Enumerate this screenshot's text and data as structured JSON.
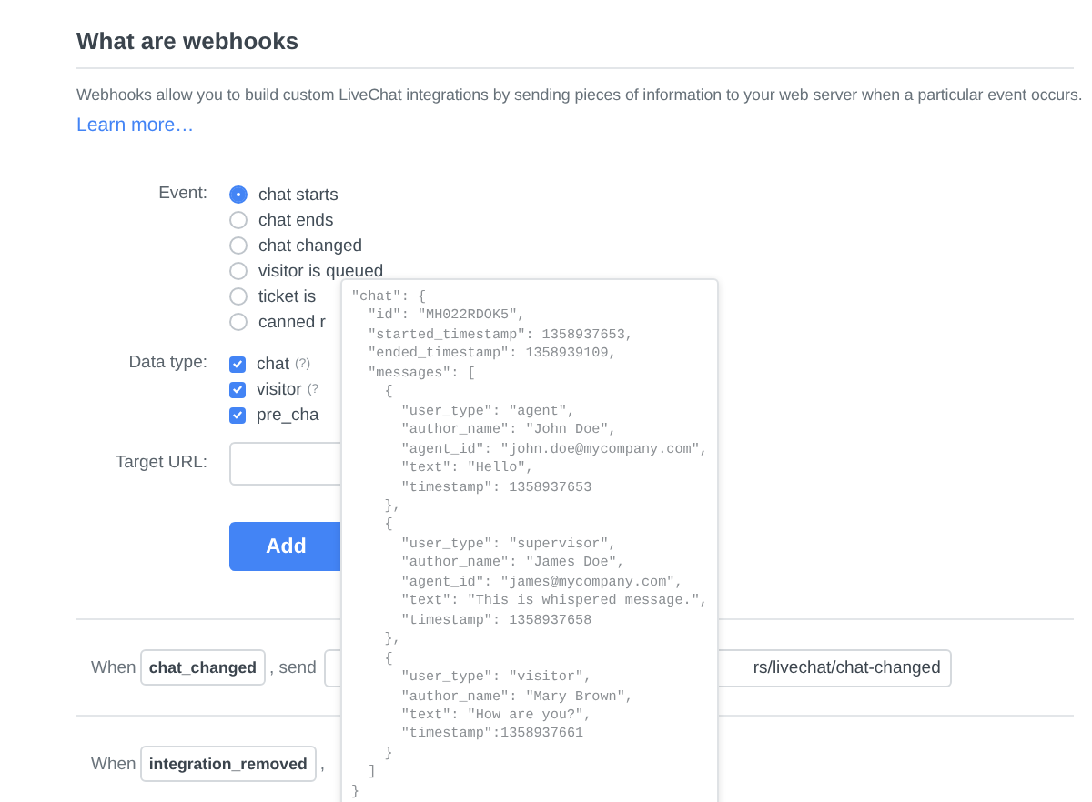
{
  "section": {
    "title": "What are webhooks",
    "description": "Webhooks allow you to build custom LiveChat integrations by sending pieces of information to your web server when a particular event occurs.",
    "link": "Learn more…"
  },
  "form": {
    "event_label": "Event:",
    "events": [
      {
        "label": "chat starts",
        "selected": true
      },
      {
        "label": "chat ends",
        "selected": false
      },
      {
        "label": "chat changed",
        "selected": false
      },
      {
        "label": "visitor is queued",
        "selected": false
      },
      {
        "label": "ticket is",
        "selected": false
      },
      {
        "label": "canned r",
        "selected": false
      }
    ],
    "data_type_label": "Data type:",
    "data_types": [
      {
        "label": "chat",
        "hint": "(?)",
        "checked": true
      },
      {
        "label": "visitor",
        "hint": "(?",
        "checked": true
      },
      {
        "label": "pre_cha",
        "checked": true
      }
    ],
    "target_url_label": "Target URL:",
    "add_button": "Add"
  },
  "webhooks": [
    {
      "when": "When",
      "event": "chat_changed",
      "send": ", send",
      "url": "rs/livechat/chat-changed"
    },
    {
      "when": "When",
      "event": "integration_removed",
      "send": ","
    }
  ],
  "popover": {
    "lines": [
      "\"chat\": {",
      "  \"id\": \"MH022RDOK5\",",
      "  \"started_timestamp\": 1358937653,",
      "  \"ended_timestamp\": 1358939109,",
      "  \"messages\": [",
      "    {",
      "      \"user_type\": \"agent\",",
      "      \"author_name\": \"John Doe\",",
      "      \"agent_id\": \"john.doe@mycompany.com\",",
      "      \"text\": \"Hello\",",
      "      \"timestamp\": 1358937653",
      "    },",
      "    {",
      "      \"user_type\": \"supervisor\",",
      "      \"author_name\": \"James Doe\",",
      "      \"agent_id\": \"james@mycompany.com\",",
      "      \"text\": \"This is whispered message.\",",
      "      \"timestamp\": 1358937658",
      "    },",
      "    {",
      "      \"user_type\": \"visitor\",",
      "      \"author_name\": \"Mary Brown\",",
      "      \"text\": \"How are you?\",",
      "      \"timestamp\":1358937661",
      "    }",
      "  ]",
      "}"
    ]
  }
}
